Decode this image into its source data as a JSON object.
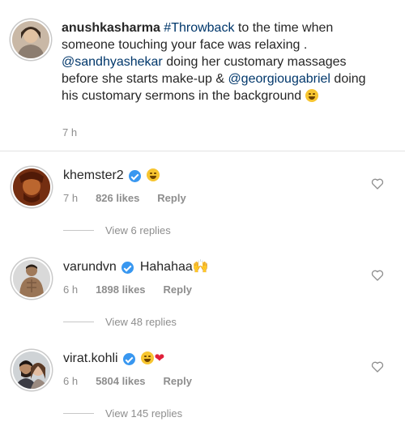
{
  "caption": {
    "username": "anushkasharma",
    "hashtag": "#Throwback",
    "text_1": " to the time when someone touching your face was relaxing . ",
    "mention_1": "@sandhyashekar",
    "text_2": " doing her customary massages before she starts make-up & ",
    "mention_2": "@georgiougabriel",
    "text_3": " doing his customary sermons in the background",
    "emoji": "grinning-sweat-emoji",
    "time": "7 h"
  },
  "comments": [
    {
      "username": "khemster2",
      "verified": true,
      "text": "😂",
      "time": "7 h",
      "likes": "826 likes",
      "reply_label": "Reply",
      "view_replies": "View 6 replies"
    },
    {
      "username": "varundvn",
      "verified": true,
      "text": "Hahahaa🙌",
      "time": "6 h",
      "likes": "1898 likes",
      "reply_label": "Reply",
      "view_replies": "View 48 replies"
    },
    {
      "username": "virat.kohli",
      "verified": true,
      "text": "😂",
      "text_heart": "❤",
      "time": "6 h",
      "likes": "5804 likes",
      "reply_label": "Reply",
      "view_replies": "View 145 replies"
    }
  ],
  "icons": {
    "like": "heart-outline-icon",
    "verified": "verified-badge-icon"
  },
  "colors": {
    "link": "#00376b",
    "verified": "#3897f0",
    "meta": "#8e8e8e",
    "heart": "#e0203a"
  }
}
